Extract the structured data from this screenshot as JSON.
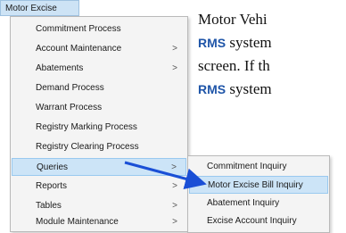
{
  "menubar": {
    "label": "Motor Excise"
  },
  "menu": {
    "items": [
      {
        "label": "Commitment Process",
        "submenu": false,
        "highlight": false
      },
      {
        "label": "Account Maintenance",
        "submenu": true,
        "highlight": false
      },
      {
        "label": "Abatements",
        "submenu": true,
        "highlight": false
      },
      {
        "label": "Demand Process",
        "submenu": false,
        "highlight": false
      },
      {
        "label": "Warrant Process",
        "submenu": false,
        "highlight": false
      },
      {
        "label": "Registry Marking Process",
        "submenu": false,
        "highlight": false
      },
      {
        "label": "Registry Clearing Process",
        "submenu": false,
        "highlight": false
      },
      {
        "label": "Queries",
        "submenu": true,
        "highlight": true
      },
      {
        "label": "Reports",
        "submenu": true,
        "highlight": false
      },
      {
        "label": "Tables",
        "submenu": true,
        "highlight": false
      },
      {
        "label": "Module Maintenance",
        "submenu": true,
        "highlight": false
      }
    ],
    "arrow_glyph": ">"
  },
  "submenu": {
    "items": [
      {
        "label": "Commitment Inquiry",
        "highlight": false
      },
      {
        "label": "Motor Excise Bill Inquiry",
        "highlight": true
      },
      {
        "label": "Abatement Inquiry",
        "highlight": false
      },
      {
        "label": "Excise Account Inquiry",
        "highlight": false
      }
    ]
  },
  "body_text": {
    "line1": "Motor Vehi",
    "line2_bold": "RMS",
    "line2_rest": " system",
    "line3": "screen. If th",
    "line4_bold": "RMS",
    "line4_rest": " system"
  },
  "annotation": {
    "arrow_color": "#1a4fd6"
  }
}
